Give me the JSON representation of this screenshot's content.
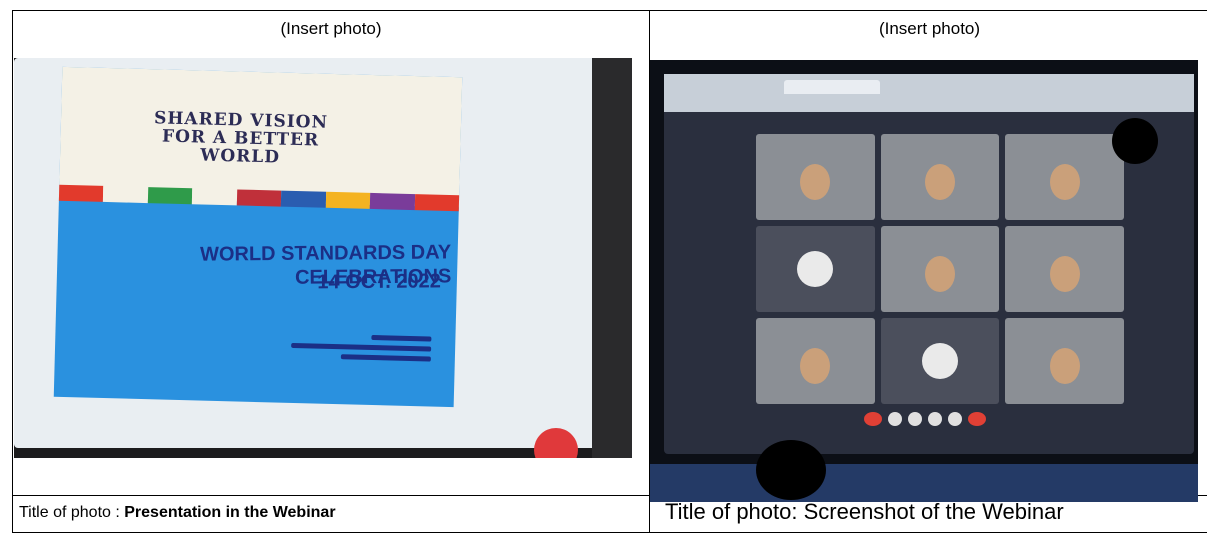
{
  "table": {
    "left_cell": {
      "insert_label": "(Insert photo)",
      "caption_prefix": "Title of photo : ",
      "caption_title": "Presentation in the Webinar"
    },
    "right_cell": {
      "insert_label": "(Insert photo)",
      "caption": "Title of photo: Screenshot of the Webinar"
    }
  },
  "photo_left": {
    "slide_headline": "SHARED VISION FOR A BETTER WORLD",
    "slide_title": "WORLD STANDARDS DAY CELEBRATIONS",
    "slide_date": "14 OCT. 2022",
    "accent_color": "#2a91df"
  },
  "photo_right": {
    "tile_count": 9
  }
}
